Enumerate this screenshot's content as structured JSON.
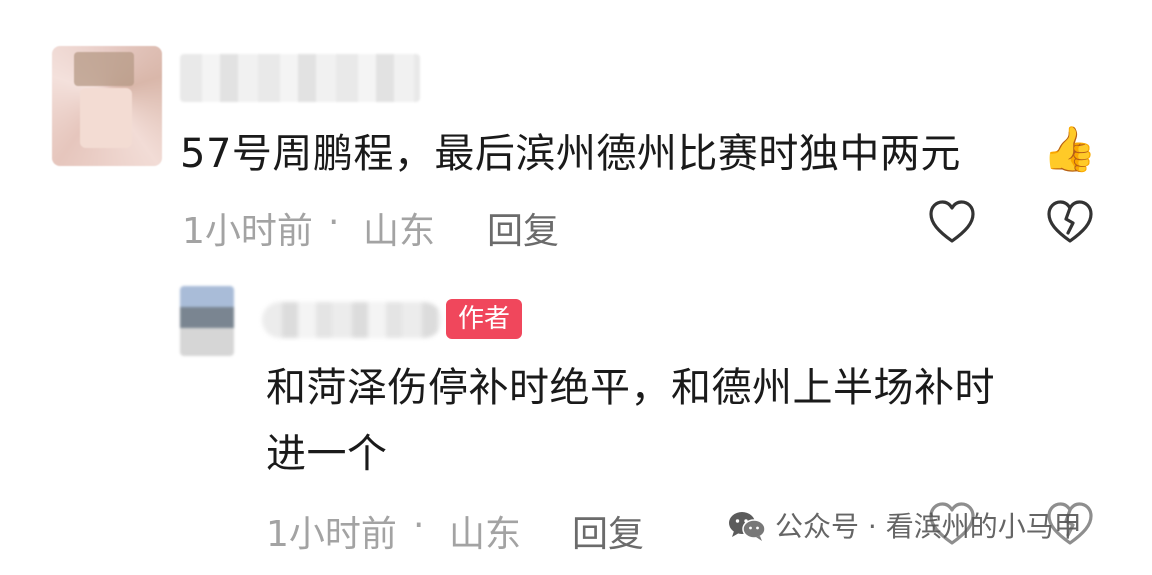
{
  "comment": {
    "text": "57号周鹏程，最后滨州德州比赛时独中两元",
    "emoji": "👍",
    "time": "1小时前",
    "dot": "·",
    "location": "山东",
    "reply_label": "回复",
    "icons": [
      "heart-icon",
      "dislike-heart-icon"
    ]
  },
  "reply": {
    "badge": "作者",
    "text_line1": "和菏泽伤停补时绝平，和德州上半场补时",
    "text_line2": "进一个",
    "time": "1小时前",
    "dot": "·",
    "location": "山东",
    "reply_label": "回复",
    "icons": [
      "heart-icon",
      "dislike-heart-icon"
    ]
  },
  "watermark": {
    "text": "公众号 · 看滨州的小马甲",
    "icon": "wechat-icon"
  },
  "colors": {
    "badge": "#f0475c",
    "meta": "#a3a3a3",
    "reply_button": "#6b6b6b",
    "text": "#1a1a1a"
  }
}
